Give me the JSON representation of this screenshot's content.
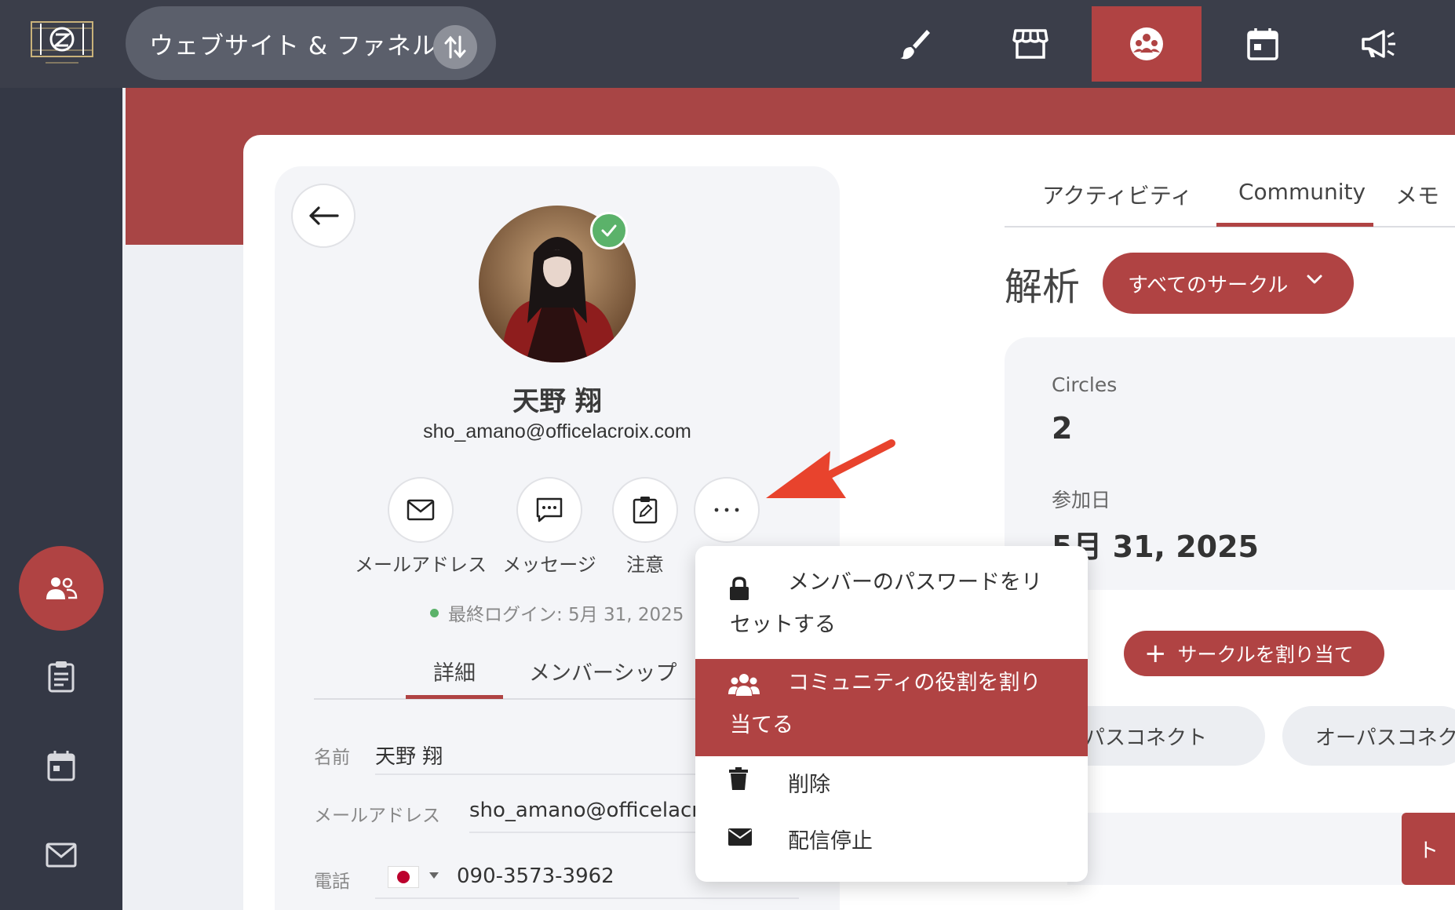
{
  "topbar": {
    "site_switch_label": "ウェブサイト & ファネル",
    "icons": [
      "brush-icon",
      "store-icon",
      "community-icon",
      "calendar-icon",
      "megaphone-icon"
    ],
    "active_icon": "community-icon"
  },
  "rail": {
    "items": [
      "members-icon",
      "clipboard-icon",
      "calendar-icon",
      "mail-icon"
    ],
    "active": "members-icon"
  },
  "profile": {
    "name": "天野 翔",
    "email": "sho_amano@officelacroix.com",
    "actions": [
      {
        "label": "メールアドレス",
        "icon": "mail-icon"
      },
      {
        "label": "メッセージ",
        "icon": "message-icon"
      },
      {
        "label": "注意",
        "icon": "note-icon"
      },
      {
        "label": "",
        "icon": "more-icon"
      }
    ],
    "last_login": "最終ログイン: 5月 31, 2025",
    "tabs": [
      "詳細",
      "メンバーシップ"
    ],
    "active_tab": "詳細",
    "fields": {
      "name_label": "名前",
      "name_value": "天野 翔",
      "email_label": "メールアドレス",
      "email_value": "sho_amano@officelacroix.com",
      "phone_label": "電話",
      "phone_value": "090-3573-3962"
    }
  },
  "right": {
    "tabs": [
      "アクティビティ",
      "Community",
      "メモ"
    ],
    "active_tab": "Community",
    "section_title": "解析",
    "circle_select": "すべてのサークル",
    "stats": {
      "circles_label": "Circles",
      "circles_value": "2",
      "joined_label": "参加日",
      "joined_value": "5月 31, 2025"
    },
    "assign_button": "サークルを割り当て",
    "chips": [
      "パスコネクト",
      "オーパスコネクト"
    ],
    "side_button_char": "ト"
  },
  "menu": {
    "items": [
      {
        "line1": "メンバーのパスワードをリ",
        "line2": "セットする",
        "icon": "lock-icon"
      },
      {
        "line1": "コミュニティの役割を割り",
        "line2": "当てる",
        "icon": "people-icon",
        "active": true
      },
      {
        "line1": "削除",
        "icon": "trash-icon"
      },
      {
        "line1": "配信停止",
        "icon": "envelope-icon"
      }
    ]
  },
  "colors": {
    "accent": "#b04343",
    "topbar": "#3b3e4a",
    "rail": "#343845",
    "verified": "#5bb26a"
  }
}
